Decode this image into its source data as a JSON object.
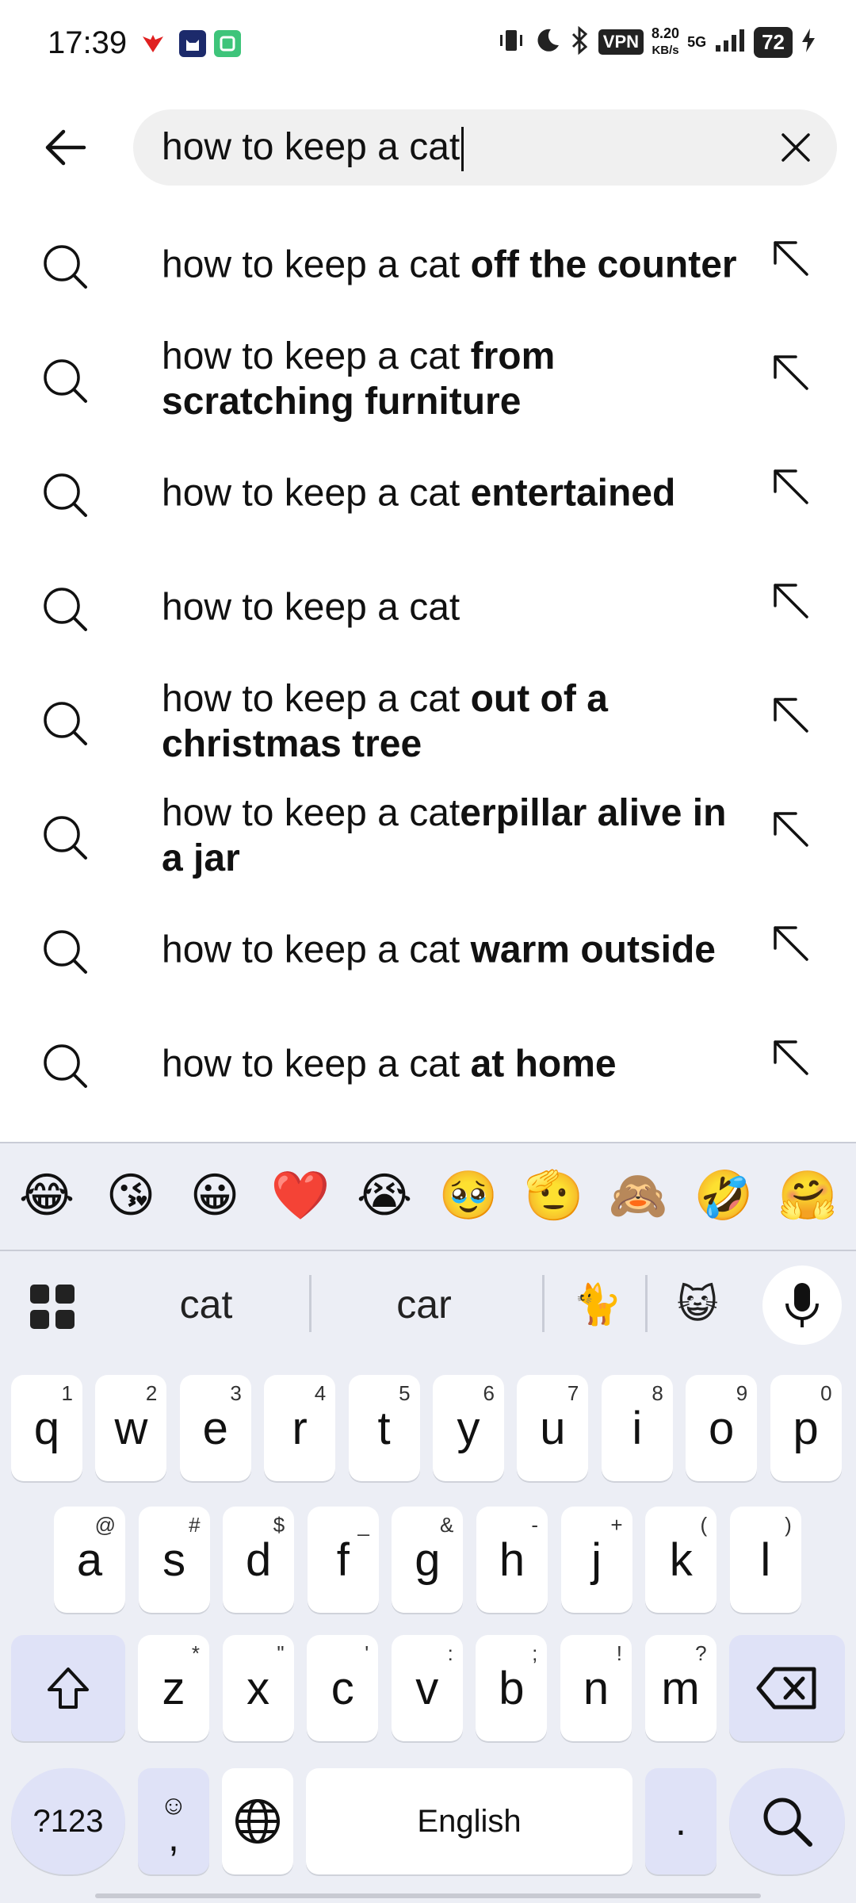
{
  "status_bar": {
    "time": "17:39",
    "vpn": "VPN",
    "speed_value": "8.20",
    "speed_unit": "KB/s",
    "network": "5G",
    "battery": "72"
  },
  "search": {
    "query": "how to keep a cat"
  },
  "suggestions": [
    {
      "prefix": "how to keep a cat",
      "suffix": " off the counter"
    },
    {
      "prefix": "how to keep a cat",
      "suffix": " from scratching furniture"
    },
    {
      "prefix": "how to keep a cat",
      "suffix": " entertained"
    },
    {
      "prefix": "how to keep a cat",
      "suffix": ""
    },
    {
      "prefix": "how to keep a cat",
      "suffix": " out of a christmas tree"
    },
    {
      "prefix": "how to keep a cat",
      "suffix": "erpillar alive in a jar"
    },
    {
      "prefix": "how to keep a cat",
      "suffix": " warm outside"
    },
    {
      "prefix": "how to keep a cat",
      "suffix": " at home"
    }
  ],
  "keyboard": {
    "emojis": [
      "😂",
      "😘",
      "😀",
      "❤️",
      "😭",
      "🥹",
      "🫡",
      "🙈",
      "🤣",
      "🤗"
    ],
    "word_suggestions": [
      "cat",
      "car"
    ],
    "emoji_suggestions": [
      "🐈",
      "😺"
    ],
    "row1": [
      {
        "k": "q",
        "h": "1"
      },
      {
        "k": "w",
        "h": "2"
      },
      {
        "k": "e",
        "h": "3"
      },
      {
        "k": "r",
        "h": "4"
      },
      {
        "k": "t",
        "h": "5"
      },
      {
        "k": "y",
        "h": "6"
      },
      {
        "k": "u",
        "h": "7"
      },
      {
        "k": "i",
        "h": "8"
      },
      {
        "k": "o",
        "h": "9"
      },
      {
        "k": "p",
        "h": "0"
      }
    ],
    "row2": [
      {
        "k": "a",
        "h": "@"
      },
      {
        "k": "s",
        "h": "#"
      },
      {
        "k": "d",
        "h": "$"
      },
      {
        "k": "f",
        "h": "_"
      },
      {
        "k": "g",
        "h": "&"
      },
      {
        "k": "h",
        "h": "-"
      },
      {
        "k": "j",
        "h": "+"
      },
      {
        "k": "k",
        "h": "("
      },
      {
        "k": "l",
        "h": ")"
      }
    ],
    "row3": [
      {
        "k": "z",
        "h": "*"
      },
      {
        "k": "x",
        "h": "\""
      },
      {
        "k": "c",
        "h": "'"
      },
      {
        "k": "v",
        "h": ":"
      },
      {
        "k": "b",
        "h": ";"
      },
      {
        "k": "n",
        "h": "!"
      },
      {
        "k": "m",
        "h": "?"
      }
    ],
    "symbols_label": "?123",
    "comma_label": ",",
    "space_label": "English",
    "period_label": "."
  }
}
